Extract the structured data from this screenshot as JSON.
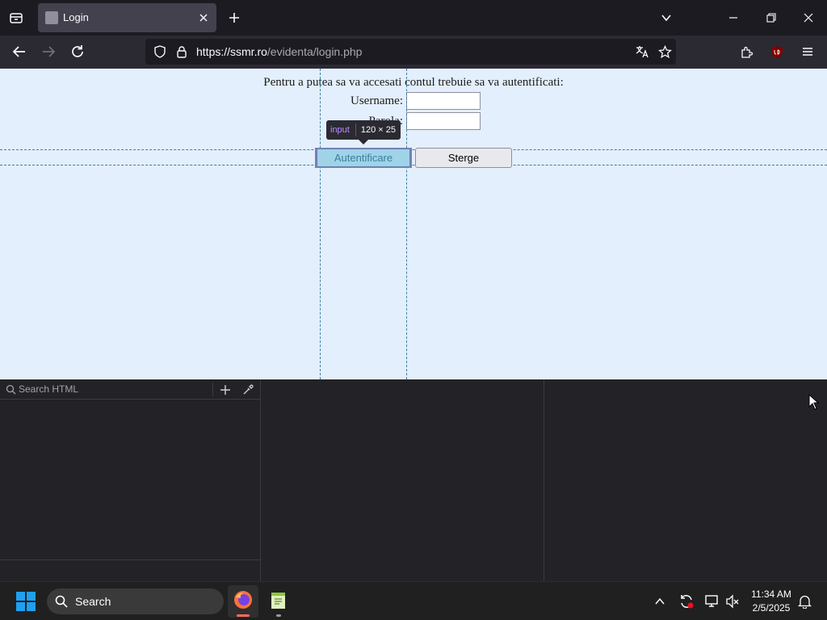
{
  "browser": {
    "tab": {
      "title": "Login"
    },
    "url": {
      "host": "https://ssmr.ro",
      "path": "/evidenta/login.php"
    }
  },
  "page": {
    "intro": "Pentru a putea sa va accesati contul trebuie sa va autentificati:",
    "username_label": "Username:",
    "password_label": "Parola:",
    "username_value": "",
    "password_value": "",
    "submit_label": "Autentificare",
    "reset_label": "Sterge"
  },
  "inspector": {
    "tooltip_tag": "input",
    "tooltip_dims": "120 × 25",
    "search_placeholder": "Search HTML"
  },
  "taskbar": {
    "search_label": "Search",
    "time": "11:34 AM",
    "date": "2/5/2025"
  },
  "colors": {
    "page_bg": "#e3effc",
    "highlight": "#9fd4e8",
    "tooltip_tag": "#b98eff"
  }
}
